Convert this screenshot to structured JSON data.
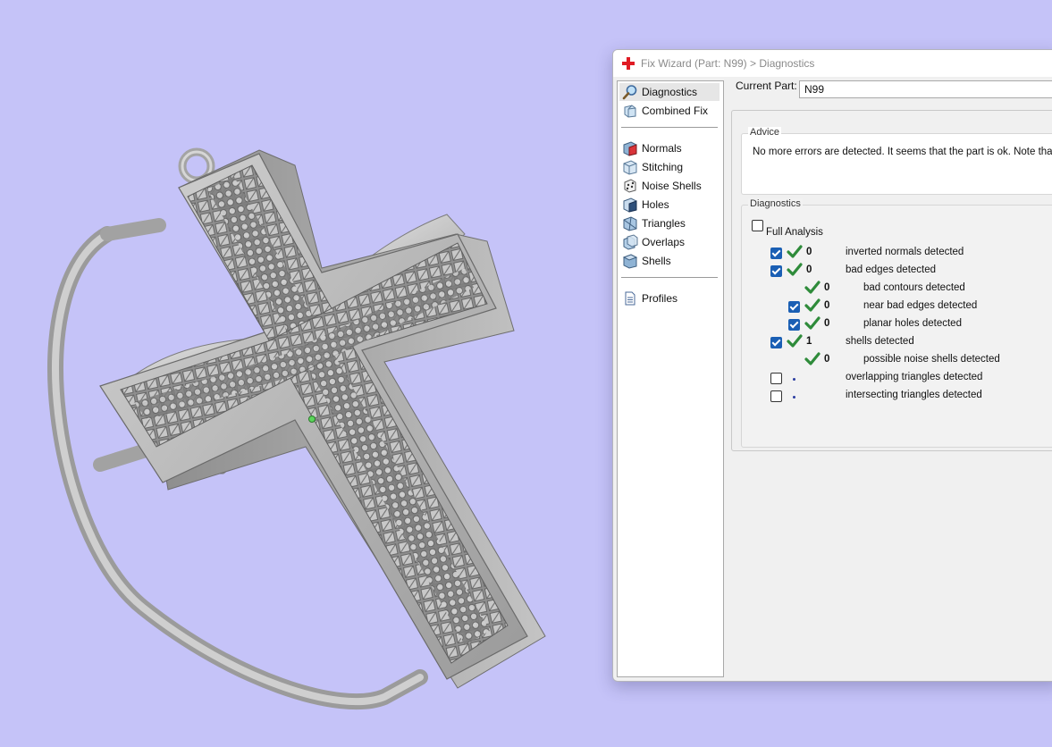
{
  "window": {
    "title": "Fix Wizard (Part: N99) > Diagnostics"
  },
  "nav": {
    "items": [
      {
        "label": "Diagnostics",
        "icon": "magnifier-icon",
        "selected": true
      },
      {
        "label": "Combined Fix",
        "icon": "combined-fix-icon"
      },
      {
        "label": "Normals",
        "icon": "normals-icon"
      },
      {
        "label": "Stitching",
        "icon": "stitching-icon"
      },
      {
        "label": "Noise Shells",
        "icon": "noise-shells-icon"
      },
      {
        "label": "Holes",
        "icon": "holes-icon"
      },
      {
        "label": "Triangles",
        "icon": "triangles-icon"
      },
      {
        "label": "Overlaps",
        "icon": "overlaps-icon"
      },
      {
        "label": "Shells",
        "icon": "shells-icon"
      },
      {
        "label": "Profiles",
        "icon": "profiles-icon"
      }
    ]
  },
  "current_part": {
    "label": "Current Part:",
    "value": "N99"
  },
  "advice": {
    "title": "Advice",
    "text": "No more errors are detected. It seems that the part is ok. Note that n"
  },
  "diagnostics": {
    "title": "Diagnostics",
    "full_analysis_label": "Full Analysis",
    "full_analysis_checked": false,
    "rows": [
      {
        "checkbox": "checked",
        "status": "ok",
        "count": "0",
        "label": "inverted normals detected",
        "indent": 0
      },
      {
        "checkbox": "checked",
        "status": "ok",
        "count": "0",
        "label": "bad edges detected",
        "indent": 0
      },
      {
        "checkbox": "none",
        "status": "ok",
        "count": "0",
        "label": "bad contours detected",
        "indent": 1
      },
      {
        "checkbox": "checked",
        "status": "ok",
        "count": "0",
        "label": "near bad edges detected",
        "indent": 1
      },
      {
        "checkbox": "checked",
        "status": "ok",
        "count": "0",
        "label": "planar holes detected",
        "indent": 1
      },
      {
        "checkbox": "checked",
        "status": "ok",
        "count": "1",
        "label": "shells detected",
        "indent": 0
      },
      {
        "checkbox": "none",
        "status": "ok",
        "count": "0",
        "label": "possible noise shells detected",
        "indent": 1
      },
      {
        "checkbox": "unchecked",
        "status": "pending",
        "count": "",
        "label": "overlapping triangles detected",
        "indent": 0
      },
      {
        "checkbox": "unchecked",
        "status": "pending",
        "count": "",
        "label": "intersecting triangles detected",
        "indent": 0
      }
    ]
  },
  "colors": {
    "background": "#c5c3f8",
    "model": "#b9b9b9",
    "check_green": "#2e8b3a",
    "checkbox_blue": "#1a5fb4"
  }
}
